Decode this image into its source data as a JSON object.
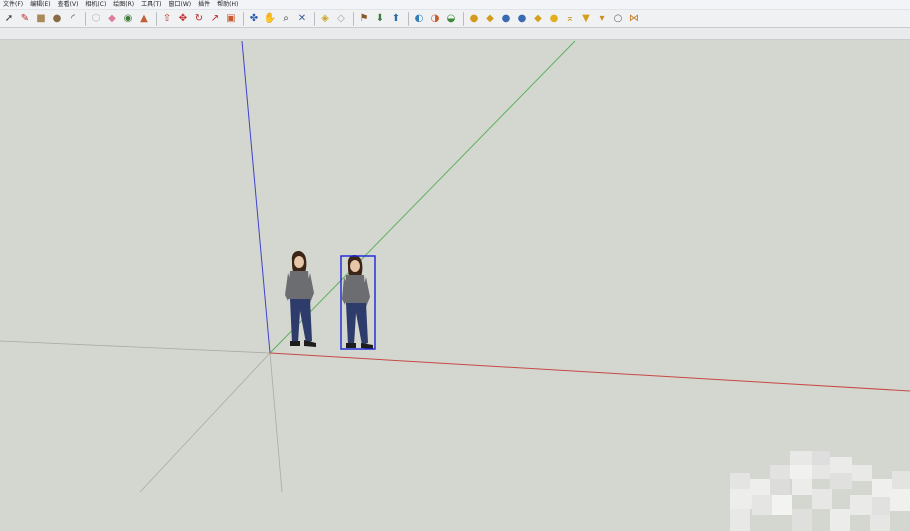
{
  "menu": {
    "items": [
      {
        "id": "file",
        "label": "文件(F)"
      },
      {
        "id": "edit",
        "label": "编辑(E)"
      },
      {
        "id": "view",
        "label": "查看(V)"
      },
      {
        "id": "camera",
        "label": "相机(C)"
      },
      {
        "id": "draw",
        "label": "绘图(R)"
      },
      {
        "id": "tools",
        "label": "工具(T)"
      },
      {
        "id": "window",
        "label": "窗口(W)"
      },
      {
        "id": "plugins",
        "label": "插件"
      },
      {
        "id": "help",
        "label": "帮助(H)"
      }
    ]
  },
  "toolbar": {
    "tools": [
      {
        "icon": "select-arrow-icon",
        "glyph": "➚",
        "color": "#333333"
      },
      {
        "icon": "pencil-line-icon",
        "glyph": "✎",
        "color": "#c0282b"
      },
      {
        "icon": "rectangle-icon",
        "glyph": "■",
        "color": "#a98a5a"
      },
      {
        "icon": "circle-icon",
        "glyph": "●",
        "color": "#8a6b46"
      },
      {
        "icon": "arc-icon",
        "glyph": "◜",
        "color": "#444444"
      },
      {
        "sep": true
      },
      {
        "icon": "make-component-icon",
        "glyph": "⬡",
        "color": "#b8b8b8"
      },
      {
        "icon": "eraser-icon",
        "glyph": "◆",
        "color": "#e07a9a"
      },
      {
        "icon": "tape-measure-icon",
        "glyph": "◉",
        "color": "#3f7d3f"
      },
      {
        "icon": "paint-bucket-icon",
        "glyph": "▲",
        "color": "#c0603a"
      },
      {
        "sep": true
      },
      {
        "icon": "push-pull-icon",
        "glyph": "⇧",
        "color": "#b8402a"
      },
      {
        "icon": "move-icon",
        "glyph": "✥",
        "color": "#c02828"
      },
      {
        "icon": "rotate-icon",
        "glyph": "↻",
        "color": "#c02828"
      },
      {
        "icon": "follow-me-icon",
        "glyph": "↗",
        "color": "#c02828"
      },
      {
        "icon": "offset-icon",
        "glyph": "▣",
        "color": "#c85a30"
      },
      {
        "sep": true
      },
      {
        "icon": "orbit-icon",
        "glyph": "✤",
        "color": "#2a5ca8"
      },
      {
        "icon": "pan-icon",
        "glyph": "✋",
        "color": "#555555"
      },
      {
        "icon": "zoom-icon",
        "glyph": "⌕",
        "color": "#333333"
      },
      {
        "icon": "zoom-extents-icon",
        "glyph": "✕",
        "color": "#3a5f9a"
      },
      {
        "sep": true
      },
      {
        "icon": "previous-view-icon",
        "glyph": "◈",
        "color": "#c9a227"
      },
      {
        "icon": "next-view-icon",
        "glyph": "◇",
        "color": "#a0a0a0"
      },
      {
        "sep": true
      },
      {
        "icon": "add-location-icon",
        "glyph": "⚑",
        "color": "#8a5a2a"
      },
      {
        "icon": "get-models-icon",
        "glyph": "⬇",
        "color": "#3c7a3c"
      },
      {
        "icon": "share-model-icon",
        "glyph": "⬆",
        "color": "#2e6ea8"
      },
      {
        "sep": true
      },
      {
        "icon": "get-photo-texture-icon",
        "glyph": "◐",
        "color": "#2e7eb8"
      },
      {
        "icon": "extension-warehouse-icon",
        "glyph": "◑",
        "color": "#c85a28"
      },
      {
        "icon": "layout-icon",
        "glyph": "◒",
        "color": "#3a8a3a"
      },
      {
        "sep": true
      },
      {
        "icon": "sandbox-from-contours-icon",
        "glyph": "●",
        "color": "#d49a1a"
      },
      {
        "icon": "sandbox-from-scratch-icon",
        "glyph": "◆",
        "color": "#d49a1a"
      },
      {
        "icon": "smoove-icon",
        "glyph": "●",
        "color": "#3a6ab0"
      },
      {
        "icon": "stamp-icon",
        "glyph": "●",
        "color": "#3a6ab0"
      },
      {
        "icon": "drape-icon",
        "glyph": "◆",
        "color": "#d4a01a"
      },
      {
        "icon": "add-detail-icon",
        "glyph": "●",
        "color": "#e0b020"
      },
      {
        "icon": "flip-edge-icon",
        "glyph": "⌅",
        "color": "#c89020"
      },
      {
        "icon": "position-camera-icon",
        "glyph": "▼",
        "color": "#d4a01a"
      },
      {
        "icon": "walk-icon",
        "glyph": "▾",
        "color": "#c89020"
      },
      {
        "icon": "look-around-icon",
        "glyph": "○",
        "color": "#666666"
      },
      {
        "icon": "section-plane-icon",
        "glyph": "⋈",
        "color": "#c87820"
      }
    ]
  },
  "viewport": {
    "background": "#d4d6d0",
    "axes": {
      "red": "#c74a46",
      "green": "#5cb35c",
      "blue": "#3c44cc",
      "ghost": "#a9aba5"
    },
    "selection_color": "#1a24d8",
    "components": [
      {
        "name": "person-figure",
        "selected": false
      },
      {
        "name": "person-figure-copy",
        "selected": true
      }
    ]
  }
}
